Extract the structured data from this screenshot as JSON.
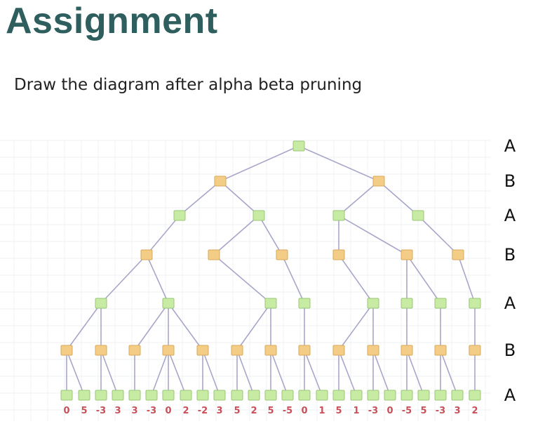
{
  "title": "Assignment",
  "subtitle": "Draw the diagram after alpha beta pruning",
  "level_labels": [
    "A",
    "B",
    "A",
    "B",
    "A",
    "B",
    "A"
  ],
  "leaf_values": [
    "0",
    "5",
    "-3",
    "3",
    "3",
    "-3",
    "0",
    "2",
    "-2",
    "3",
    "5",
    "2",
    "5",
    "-5",
    "0",
    "1",
    "5",
    "1",
    "-3",
    "0",
    "-5",
    "5",
    "-3",
    "3",
    "2"
  ],
  "colors": {
    "max_node": "#c7eba2",
    "min_node": "#f3cc85",
    "edge": "#a9a6c9",
    "leaf_value": "#c9505a",
    "title": "#2e5e5e"
  }
}
